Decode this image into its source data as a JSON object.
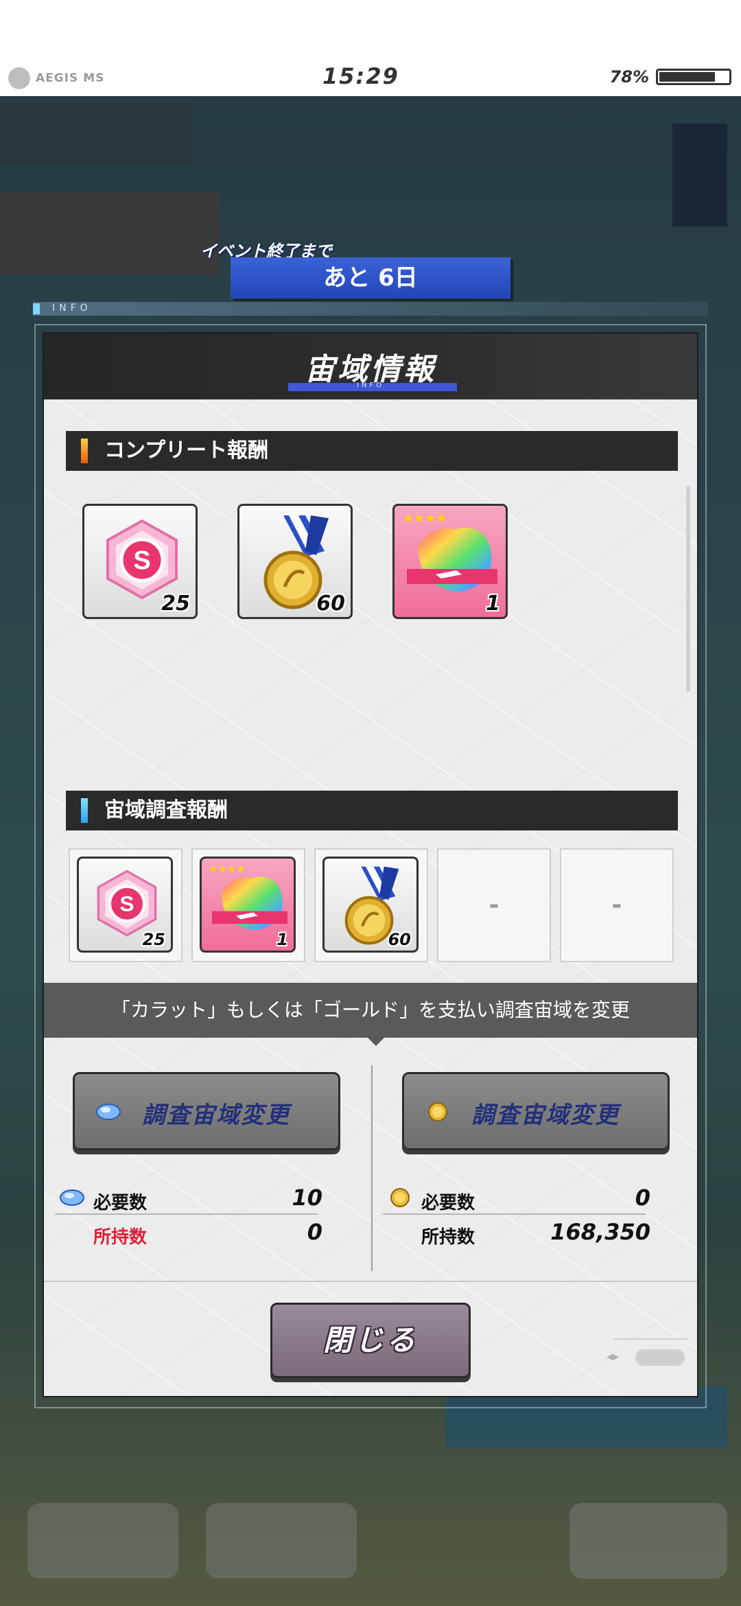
{
  "status_bar": {
    "app_logo_text": "AEGIS MS",
    "time": "15:29",
    "battery_percent": "78%",
    "battery_level": 0.78
  },
  "event": {
    "timer_label": "イベント終了まで",
    "remaining": "あと 6日",
    "info_tag": "INFO"
  },
  "dialog": {
    "title": "宙域情報",
    "title_sub": "INFO",
    "complete_rewards": {
      "header": "コンプリート報酬",
      "items": [
        {
          "icon": "s-crystal-icon",
          "count": "25"
        },
        {
          "icon": "medal-icon",
          "count": "60"
        },
        {
          "icon": "rainbow-card-icon",
          "count": "1"
        }
      ]
    },
    "survey_rewards": {
      "header": "宙域調査報酬",
      "items": [
        {
          "icon": "s-crystal-icon",
          "count": "25"
        },
        {
          "icon": "rainbow-card-icon",
          "count": "1"
        },
        {
          "icon": "medal-icon",
          "count": "60"
        },
        {
          "empty": "-"
        },
        {
          "empty": "-"
        }
      ]
    },
    "notice": "「カラット」もしくは「ゴールド」を支払い調査宙域を変更",
    "carat_option": {
      "button_label": "調査宙域変更",
      "required_label": "必要数",
      "required_value": "10",
      "owned_label": "所持数",
      "owned_value": "0"
    },
    "gold_option": {
      "button_label": "調査宙域変更",
      "required_label": "必要数",
      "required_value": "0",
      "owned_label": "所持数",
      "owned_value": "168,350"
    },
    "close_label": "閉じる"
  },
  "colors": {
    "accent_blue": "#2446b8",
    "warning_red": "#e0203a",
    "dialog_bg": "#ececec",
    "header_dark": "#2a2a2a"
  }
}
